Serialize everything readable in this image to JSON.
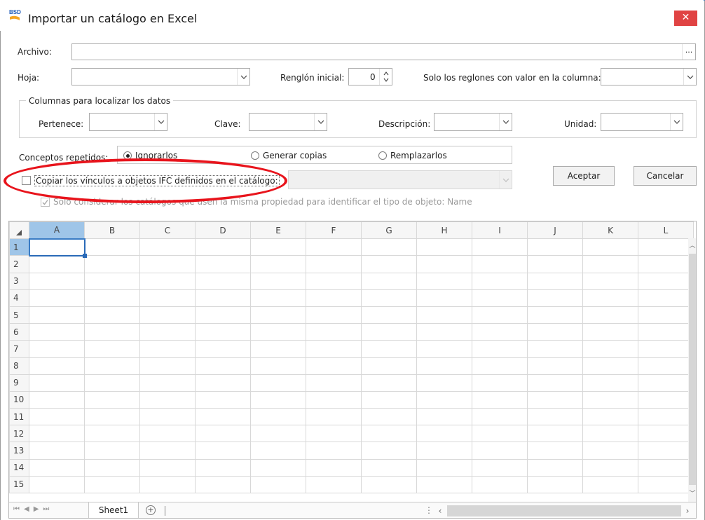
{
  "window": {
    "title": "Importar un catálogo en Excel",
    "app_icon": "bsd-app-icon",
    "close_label": "✕"
  },
  "form": {
    "archivo_label": "Archivo:",
    "archivo_value": "",
    "browse_label": "...",
    "hoja_label": "Hoja:",
    "hoja_value": "",
    "renglon_label": "Renglón inicial:",
    "renglon_value": "0",
    "solo_label": "Solo los reglones con valor en la columna:",
    "solo_value": ""
  },
  "columns_group": {
    "title": "Columnas para localizar los datos",
    "pertenece_label": "Pertenece:",
    "clave_label": "Clave:",
    "descripcion_label": "Descripción:",
    "unidad_label": "Unidad:"
  },
  "repeated": {
    "label": "Conceptos repetidos:",
    "options": [
      "Ignorarlos",
      "Generar copias",
      "Remplazarlos"
    ],
    "selected": "Ignorarlos"
  },
  "ifc": {
    "copy_label": "Copiar los vínculos a objetos IFC definidos en el catálogo:",
    "copy_checked": false,
    "consider_label": "Solo considerar los catálogos que usen la misma propiedad para identificar el tipo de objeto: Name",
    "consider_checked": true
  },
  "buttons": {
    "accept": "Aceptar",
    "cancel": "Cancelar"
  },
  "sheet": {
    "columns": [
      "A",
      "B",
      "C",
      "D",
      "E",
      "F",
      "G",
      "H",
      "I",
      "J",
      "K",
      "L"
    ],
    "rows": [
      "1",
      "2",
      "3",
      "4",
      "5",
      "6",
      "7",
      "8",
      "9",
      "10",
      "11",
      "12",
      "13",
      "14",
      "15"
    ],
    "active_cell": "A1",
    "tab_name": "Sheet1"
  },
  "colors": {
    "accent": "#2b79d0",
    "close": "#e04343",
    "highlight_oval": "#e8141c",
    "active_header": "#9fc5e8"
  }
}
